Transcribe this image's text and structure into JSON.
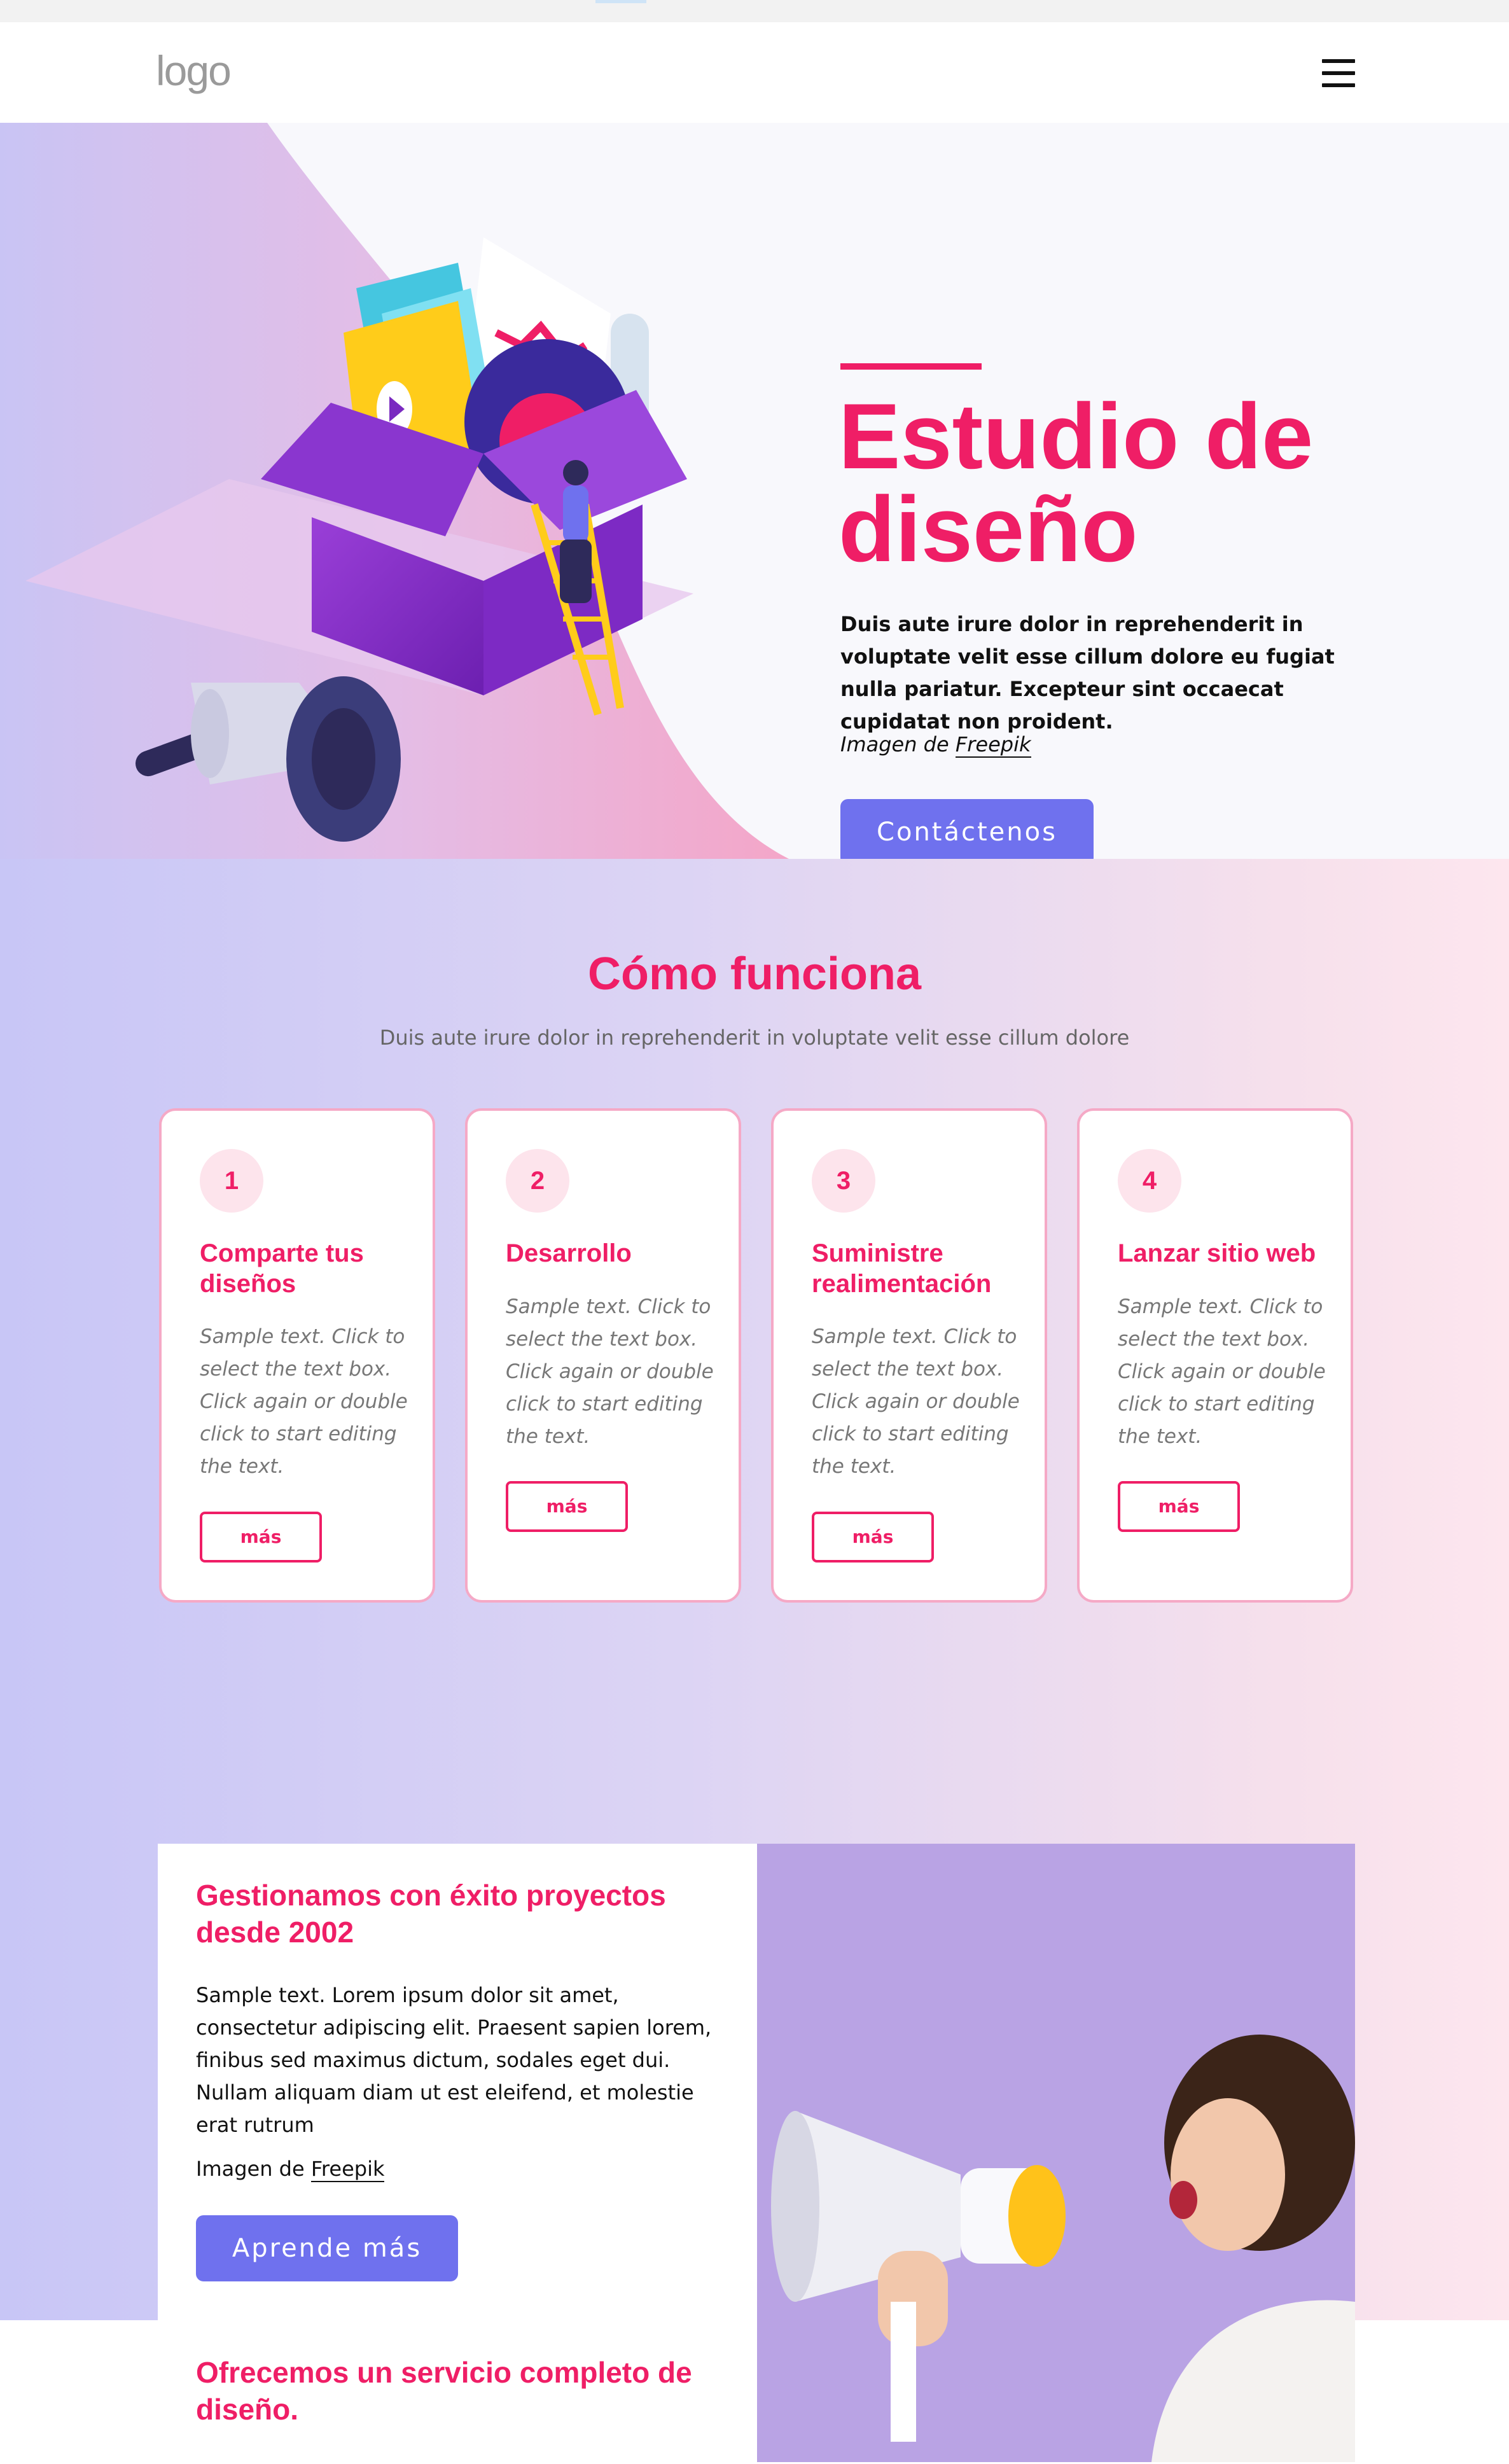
{
  "header": {
    "logo": "logo",
    "menu_icon": "hamburger-menu-icon"
  },
  "hero": {
    "title": "Estudio de diseño",
    "text": "Duis aute irure dolor in reprehenderit in voluptate velit esse cillum dolore eu fugiat nulla pariatur. Excepteur sint occaecat cupidatat non proident.",
    "credit_prefix": "Imagen de",
    "credit_link": "Freepik",
    "button": "Contáctenos",
    "illustration": "box-megaphone-illustration"
  },
  "how": {
    "title": "Cómo funciona",
    "subtitle": "Duis aute irure dolor in reprehenderit in voluptate velit esse cillum dolore",
    "cards": [
      {
        "num": "1",
        "title": "Comparte tus diseños",
        "text": "Sample text. Click to select the text box. Click again or double click to start editing the text.",
        "button": "más"
      },
      {
        "num": "2",
        "title": "Desarrollo",
        "text": "Sample text. Click to select the text box. Click again or double click to start editing the text.",
        "button": "más"
      },
      {
        "num": "3",
        "title": "Suministre realimentación",
        "text": "Sample text. Click to select the text box. Click again or double click to start editing the text.",
        "button": "más"
      },
      {
        "num": "4",
        "title": "Lanzar sitio web",
        "text": "Sample text. Click to select the text box. Click again or double click to start editing the text.",
        "button": "más"
      }
    ]
  },
  "info": {
    "title": "Gestionamos con éxito proyectos desde 2002",
    "text": "Sample text. Lorem ipsum dolor sit amet, consectetur adipiscing elit. Praesent sapien lorem, finibus sed maximus dictum, sodales eget dui. Nullam aliquam diam ut est eleifend, et molestie erat rutrum",
    "credit_prefix": "Imagen de",
    "credit_link": "Freepik",
    "button": "Aprende más",
    "title2": "Ofrecemos un servicio completo de diseño.",
    "photo": "woman-megaphone-photo"
  },
  "colors": {
    "accent": "#ef1e66",
    "button": "#6f71ee",
    "card_border": "#f5a9c6"
  }
}
